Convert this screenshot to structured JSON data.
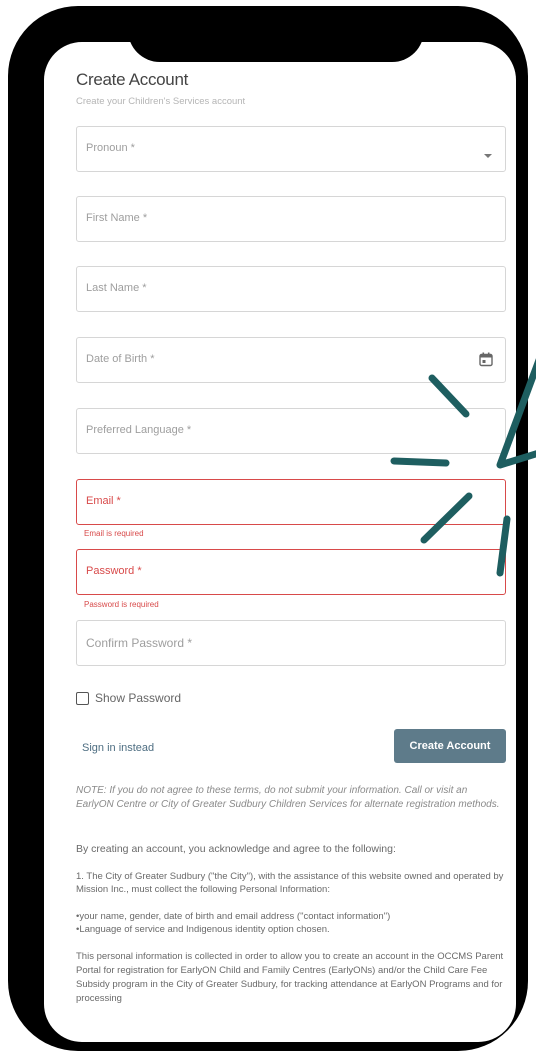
{
  "form": {
    "title": "Create Account",
    "subtitle": "Create your Children's Services account",
    "pronoun_label": "Pronoun *",
    "first_name_label": "First Name *",
    "last_name_label": "Last Name *",
    "dob_label": "Date of Birth *",
    "language_label": "Preferred Language *",
    "email_label": "Email *",
    "email_error": "Email is required",
    "password_label": "Password *",
    "password_error": "Password is required",
    "confirm_label": "Confirm Password *",
    "show_password_label": "Show Password",
    "show_password_checked": false,
    "sign_in_label": "Sign in instead",
    "create_label": "Create Account"
  },
  "terms": {
    "note": "NOTE: If you do not agree to these terms, do not submit your information. Call or visit an EarlyON Centre or City of Greater Sudbury Children Services for alternate registration methods.",
    "intro": "By creating an account, you acknowledge and agree to the following:",
    "clause1": "1. The City of Greater Sudbury (\"the City\"), with the assistance of this website owned and operated by Mission Inc., must collect the following Personal Information:",
    "bullet1": "•your name, gender, date of birth and email address (\"contact information\")",
    "bullet2": "•Language of service and Indigenous identity option chosen.",
    "clause2": "This personal information is collected in order to allow you to create an account in the OCCMS Parent Portal for registration for EarlyON Child and Family Centres (EarlyONs) and/or the Child Care Fee Subsidy program in the City of Greater Sudbury, for tracking attendance at EarlyON Programs and for processing"
  },
  "colors": {
    "error": "#d84a4a",
    "button": "#5e7b8a",
    "sparkle": "#1e5e60"
  }
}
